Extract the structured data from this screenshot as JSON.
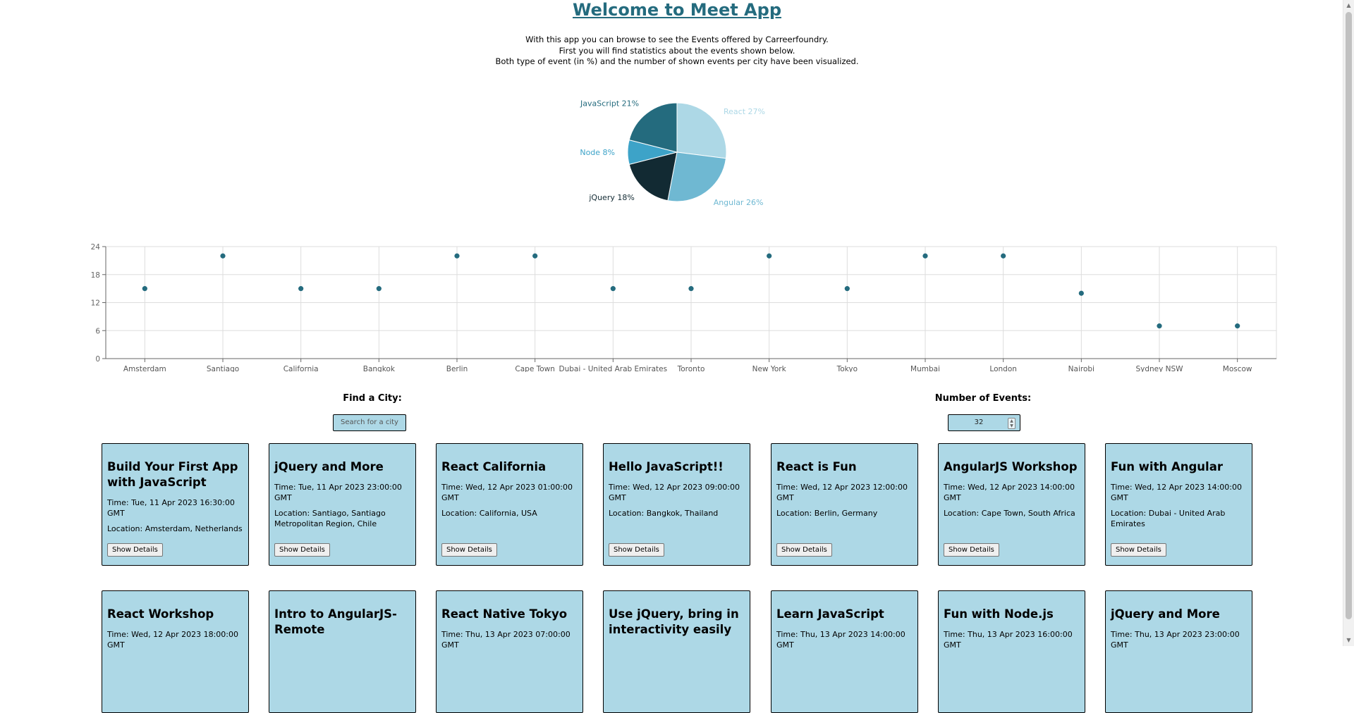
{
  "header": {
    "title": "Welcome to Meet App",
    "intro_lines": [
      "With this app you can browse to see the Events offered by Carreerfoundry.",
      "First you will find statistics about the events shown below.",
      "Both type of event (in %) and the number of shown events per city have been visualized."
    ]
  },
  "colors": {
    "accent": "#246b7e",
    "card_bg": "#add8e6",
    "pie_react": "#add8e6",
    "pie_angular": "#6fb8d2",
    "pie_jquery": "#122a33",
    "pie_node": "#3da3c8",
    "pie_javascript": "#246b7e",
    "scatter_point": "#246b7e"
  },
  "chart_data": [
    {
      "type": "pie",
      "labels": [
        "React",
        "Angular",
        "jQuery",
        "Node",
        "JavaScript"
      ],
      "values": [
        27,
        26,
        18,
        8,
        21
      ],
      "slice_labels": [
        "React 27%",
        "Angular 26%",
        "jQuery 18%",
        "Node 8%",
        "JavaScript 21%"
      ],
      "colors": [
        "#add8e6",
        "#6fb8d2",
        "#122a33",
        "#3da3c8",
        "#246b7e"
      ]
    },
    {
      "type": "scatter",
      "categories": [
        "Amsterdam",
        "Santiago",
        "California",
        "Bangkok",
        "Berlin",
        "Cape Town",
        "Dubai - United Arab Emirates",
        "Toronto",
        "New York",
        "Tokyo",
        "Mumbai",
        "London",
        "Nairobi",
        "Sydney NSW",
        "Moscow"
      ],
      "values": [
        15,
        22,
        15,
        15,
        22,
        22,
        15,
        15,
        22,
        15,
        22,
        22,
        14,
        7,
        7
      ],
      "ylim": [
        0,
        24
      ],
      "yticks": [
        0,
        6,
        12,
        18,
        24
      ],
      "grid": true
    }
  ],
  "controls": {
    "city_label": "Find a City:",
    "city_placeholder": "Search for a city",
    "number_label": "Number of Events:",
    "number_value": "32"
  },
  "events": [
    {
      "title": "Build Your First App with JavaScript",
      "time": "Time: Tue, 11 Apr 2023 16:30:00 GMT",
      "location": "Location: Amsterdam, Netherlands",
      "button": "Show Details"
    },
    {
      "title": "jQuery and More",
      "time": "Time: Tue, 11 Apr 2023 23:00:00 GMT",
      "location": "Location: Santiago, Santiago Metropolitan Region, Chile",
      "button": "Show Details"
    },
    {
      "title": "React California",
      "time": "Time: Wed, 12 Apr 2023 01:00:00 GMT",
      "location": "Location: California, USA",
      "button": "Show Details"
    },
    {
      "title": "Hello JavaScript!!",
      "time": "Time: Wed, 12 Apr 2023 09:00:00 GMT",
      "location": "Location: Bangkok, Thailand",
      "button": "Show Details"
    },
    {
      "title": "React is Fun",
      "time": "Time: Wed, 12 Apr 2023 12:00:00 GMT",
      "location": "Location: Berlin, Germany",
      "button": "Show Details"
    },
    {
      "title": "AngularJS Workshop",
      "time": "Time: Wed, 12 Apr 2023 14:00:00 GMT",
      "location": "Location: Cape Town, South Africa",
      "button": "Show Details"
    },
    {
      "title": "Fun with Angular",
      "time": "Time: Wed, 12 Apr 2023 14:00:00 GMT",
      "location": "Location: Dubai - United Arab Emirates",
      "button": "Show Details"
    },
    {
      "title": "React Workshop",
      "time": "Time: Wed, 12 Apr 2023 18:00:00 GMT"
    },
    {
      "title": "Intro to AngularJS-Remote"
    },
    {
      "title": "React Native Tokyo",
      "time": "Time: Thu, 13 Apr 2023 07:00:00 GMT"
    },
    {
      "title": "Use jQuery, bring in interactivity easily"
    },
    {
      "title": "Learn JavaScript",
      "time": "Time: Thu, 13 Apr 2023 14:00:00 GMT"
    },
    {
      "title": "Fun with Node.js",
      "time": "Time: Thu, 13 Apr 2023 16:00:00 GMT"
    },
    {
      "title": "jQuery and More",
      "time": "Time: Thu, 13 Apr 2023 23:00:00 GMT"
    }
  ]
}
